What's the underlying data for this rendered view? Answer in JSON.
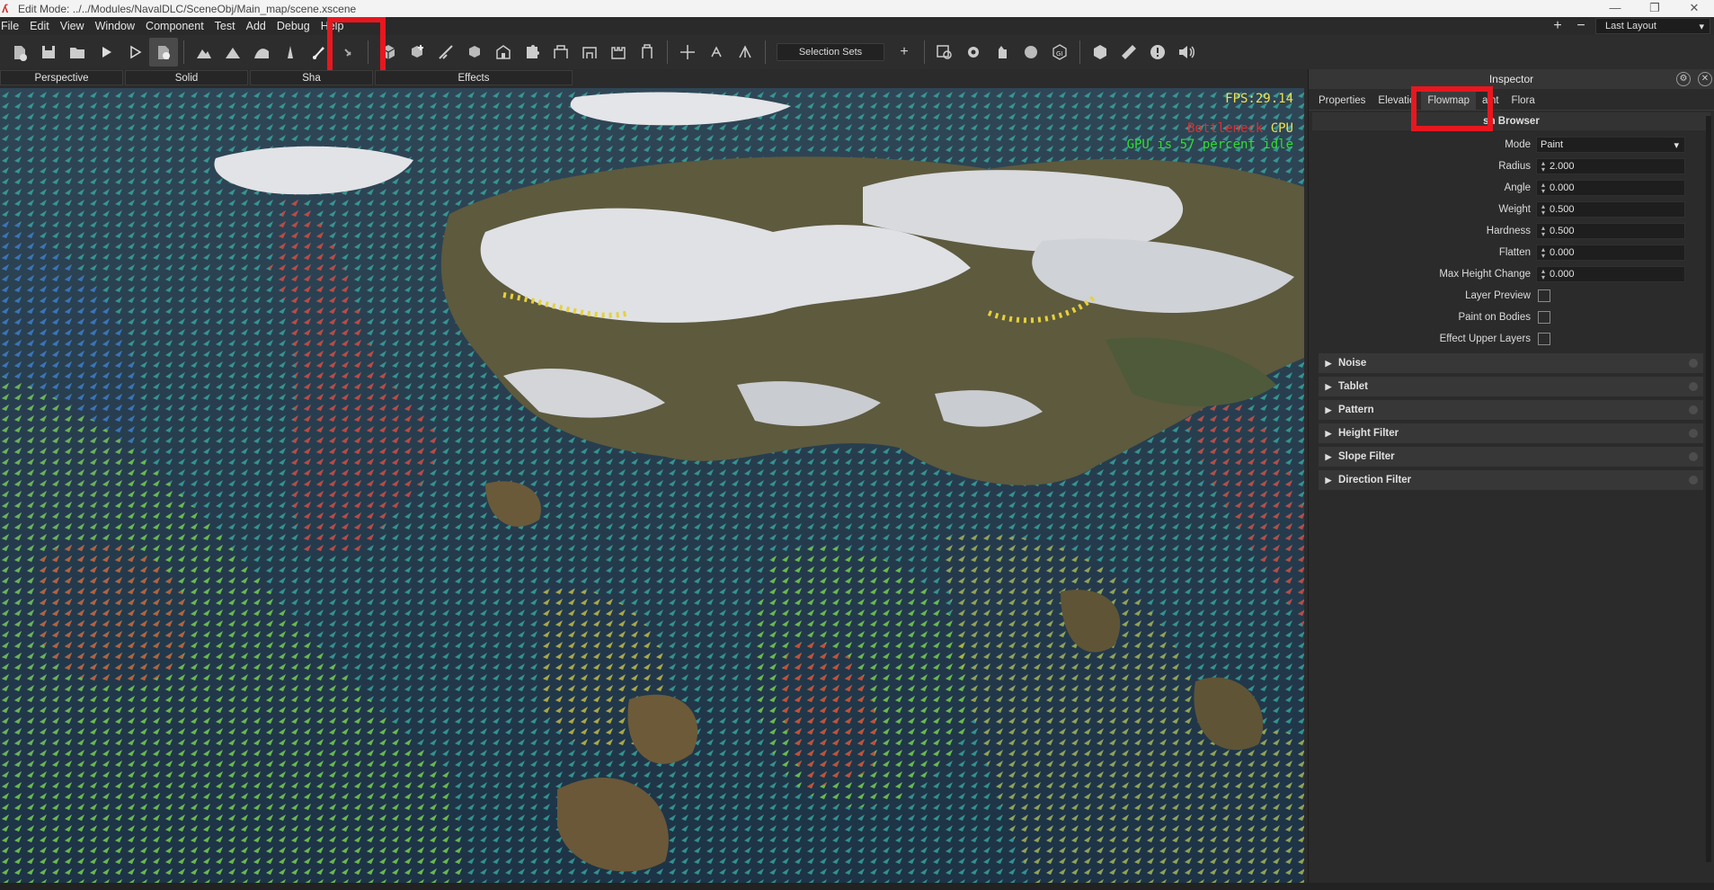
{
  "window": {
    "title": "Edit Mode: ../../Modules/NavalDLC/SceneObj/Main_map/scene.xscene",
    "minimize": "—",
    "maximize": "❐",
    "close": "✕"
  },
  "menu": {
    "items": [
      "File",
      "Edit",
      "View",
      "Window",
      "Component",
      "Test",
      "Add",
      "Debug",
      "Help"
    ],
    "add_icon": "+",
    "remove_icon": "−",
    "layout": "Last Layout"
  },
  "toolbar": {
    "selection_sets": "Selection Sets",
    "add_set": "+"
  },
  "view_tabs": [
    "Perspective",
    "Solid",
    "Sha",
    "Effects"
  ],
  "viewport": {
    "fps": "FPS:29.14",
    "bottleneck_label": "Bottleneck",
    "bottleneck_value": "CPU",
    "gpu_idle": "GPU is 57 percent idle"
  },
  "inspector": {
    "title": "Inspector",
    "tabs": [
      "Properties",
      "Elevatio",
      "Flowmap",
      "aint",
      "Flora"
    ],
    "selected_tab": "Flowmap",
    "brush_browser": "sh Browser",
    "fields": {
      "mode_label": "Mode",
      "mode_value": "Paint",
      "radius_label": "Radius",
      "radius_value": "2.000",
      "angle_label": "Angle",
      "angle_value": "0.000",
      "weight_label": "Weight",
      "weight_value": "0.500",
      "hardness_label": "Hardness",
      "hardness_value": "0.500",
      "flatten_label": "Flatten",
      "flatten_value": "0.000",
      "maxheight_label": "Max Height Change",
      "maxheight_value": "0.000",
      "layerpreview_label": "Layer Preview",
      "paintbodies_label": "Paint on Bodies",
      "effectupper_label": "Effect Upper Layers"
    },
    "sections": [
      "Noise",
      "Tablet",
      "Pattern",
      "Height Filter",
      "Slope Filter",
      "Direction Filter"
    ]
  },
  "colors": {
    "highlight": "#e8171f",
    "fps": "#f2e24a",
    "bottleneck": "#e82b2b",
    "gpu": "#2de02d"
  }
}
